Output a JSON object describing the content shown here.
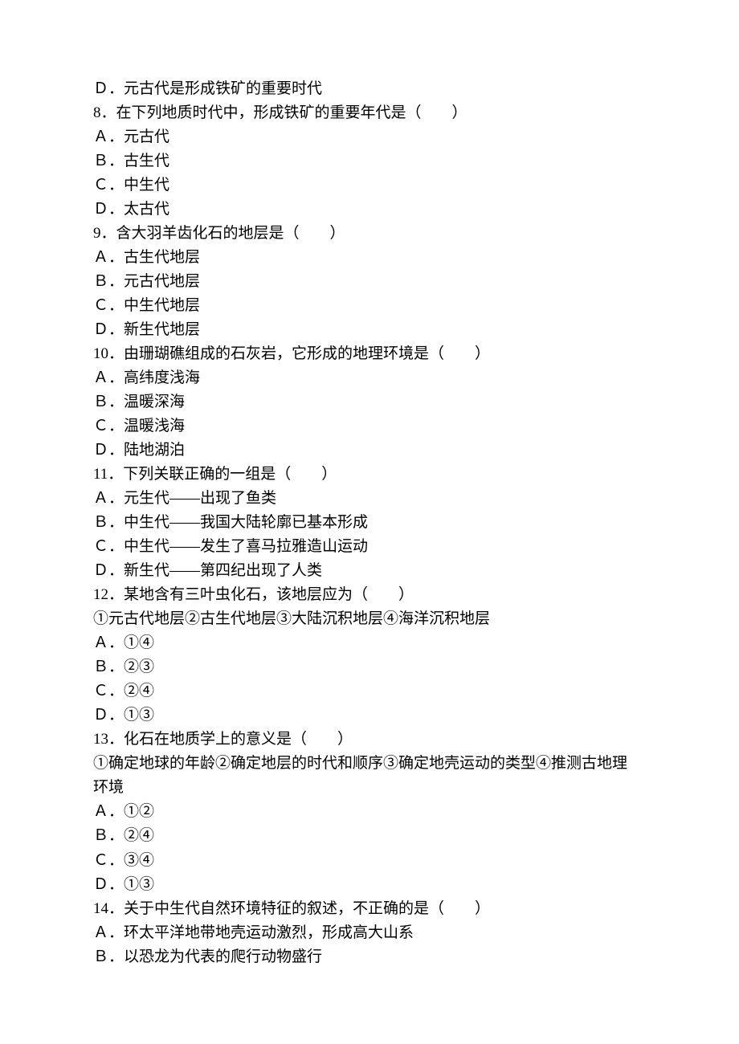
{
  "lines": {
    "l1": "Ｄ．元古代是形成铁矿的重要时代",
    "l2": "8．在下列地质时代中，形成铁矿的重要年代是（　　）",
    "l3": "Ａ．元古代",
    "l4": "Ｂ．古生代",
    "l5": "Ｃ．中生代",
    "l6": "Ｄ．太古代",
    "l7": "9．含大羽羊齿化石的地层是（　　）",
    "l8": "Ａ．古生代地层",
    "l9": "Ｂ．元古代地层",
    "l10": "Ｃ．中生代地层",
    "l11": "Ｄ．新生代地层",
    "l12": "10．由珊瑚礁组成的石灰岩，它形成的地理环境是（　　）",
    "l13": "Ａ．高纬度浅海",
    "l14": "Ｂ．温暖深海",
    "l15": "Ｃ．温暖浅海",
    "l16": "Ｄ．陆地湖泊",
    "l17": "11．下列关联正确的一组是（　　）",
    "l18": "Ａ．元生代——出现了鱼类",
    "l19": "Ｂ．中生代——我国大陆轮廓已基本形成",
    "l20": "Ｃ．中生代——发生了喜马拉雅造山运动",
    "l21": "Ｄ．新生代——第四纪出现了人类",
    "l22": "12．某地含有三叶虫化石，该地层应为（　　）",
    "l23": "①元古代地层②古生代地层③大陆沉积地层④海洋沉积地层",
    "l24": "Ａ．①④",
    "l25": "Ｂ．②③",
    "l26": "Ｃ．②④",
    "l27": "Ｄ．①③",
    "l28": "13．化石在地质学上的意义是（　　）",
    "l29": "①确定地球的年龄②确定地层的时代和顺序③确定地壳运动的类型④推测古地理",
    "l30": "环境",
    "l31": "Ａ．①②",
    "l32": "Ｂ．②④",
    "l33": "Ｃ．③④",
    "l34": "Ｄ．①③",
    "l35": "14．关于中生代自然环境特征的叙述，不正确的是（　　）",
    "l36": "Ａ．环太平洋地带地壳运动激烈，形成高大山系",
    "l37": "Ｂ．以恐龙为代表的爬行动物盛行"
  }
}
